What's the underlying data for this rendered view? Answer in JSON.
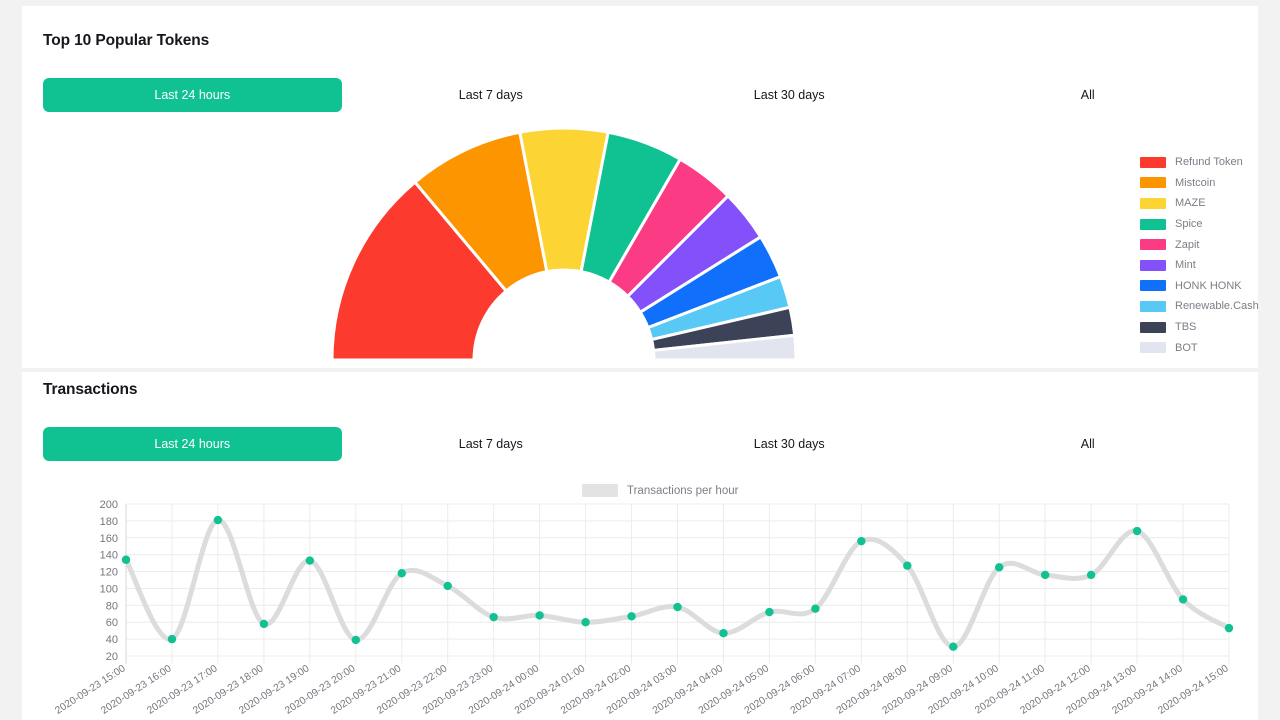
{
  "tokens_card": {
    "title": "Top 10 Popular Tokens",
    "tabs": [
      {
        "label": "Last 24 hours",
        "active": true
      },
      {
        "label": "Last 7 days",
        "active": false
      },
      {
        "label": "Last 30 days",
        "active": false
      },
      {
        "label": "All",
        "active": false
      }
    ]
  },
  "transactions_card": {
    "title": "Transactions",
    "tabs": [
      {
        "label": "Last 24 hours",
        "active": true
      },
      {
        "label": "Last 7 days",
        "active": false
      },
      {
        "label": "Last 30 days",
        "active": false
      },
      {
        "label": "All",
        "active": false
      }
    ]
  },
  "chart_data": [
    {
      "type": "pie",
      "variant": "semi-donut",
      "title": "Top 10 Popular Tokens",
      "legend_position": "right",
      "start_angle_deg": 180,
      "end_angle_deg": 0,
      "categories": [
        "Refund Token",
        "Mistcoin",
        "MAZE",
        "Spice",
        "Zapit",
        "Mint",
        "HONK HONK",
        "Renewable.Cash",
        "TBS",
        "BOT"
      ],
      "values": [
        27.8,
        16.1,
        12.2,
        10.6,
        8.3,
        7.2,
        6.1,
        4.4,
        3.9,
        3.4
      ],
      "colors": [
        "#fc3a2d",
        "#fd9500",
        "#fcd534",
        "#10c292",
        "#fb3b84",
        "#8450fa",
        "#1170fb",
        "#58c8f5",
        "#3c4257",
        "#e2e5ef"
      ]
    },
    {
      "type": "line",
      "title": "Transactions",
      "series_name": "Transactions per hour",
      "legend_label": "Transactions per hour",
      "xlabel": "",
      "ylabel": "",
      "ylim": [
        20,
        200
      ],
      "yticks": [
        20,
        40,
        60,
        80,
        100,
        120,
        140,
        160,
        180,
        200
      ],
      "grid": true,
      "line_color": "#dcdcdc",
      "point_color": "#10c292",
      "categories": [
        "2020-09-23 15:00",
        "2020-09-23 16:00",
        "2020-09-23 17:00",
        "2020-09-23 18:00",
        "2020-09-23 19:00",
        "2020-09-23 20:00",
        "2020-09-23 21:00",
        "2020-09-23 22:00",
        "2020-09-23 23:00",
        "2020-09-24 00:00",
        "2020-09-24 01:00",
        "2020-09-24 02:00",
        "2020-09-24 03:00",
        "2020-09-24 04:00",
        "2020-09-24 05:00",
        "2020-09-24 06:00",
        "2020-09-24 07:00",
        "2020-09-24 08:00",
        "2020-09-24 09:00",
        "2020-09-24 10:00",
        "2020-09-24 11:00",
        "2020-09-24 12:00",
        "2020-09-24 13:00",
        "2020-09-24 14:00",
        "2020-09-24 15:00"
      ],
      "values": [
        134,
        40,
        181,
        58,
        133,
        39,
        118,
        103,
        66,
        68,
        60,
        67,
        78,
        47,
        72,
        76,
        156,
        127,
        31,
        125,
        116,
        116,
        168,
        87,
        53
      ]
    }
  ]
}
